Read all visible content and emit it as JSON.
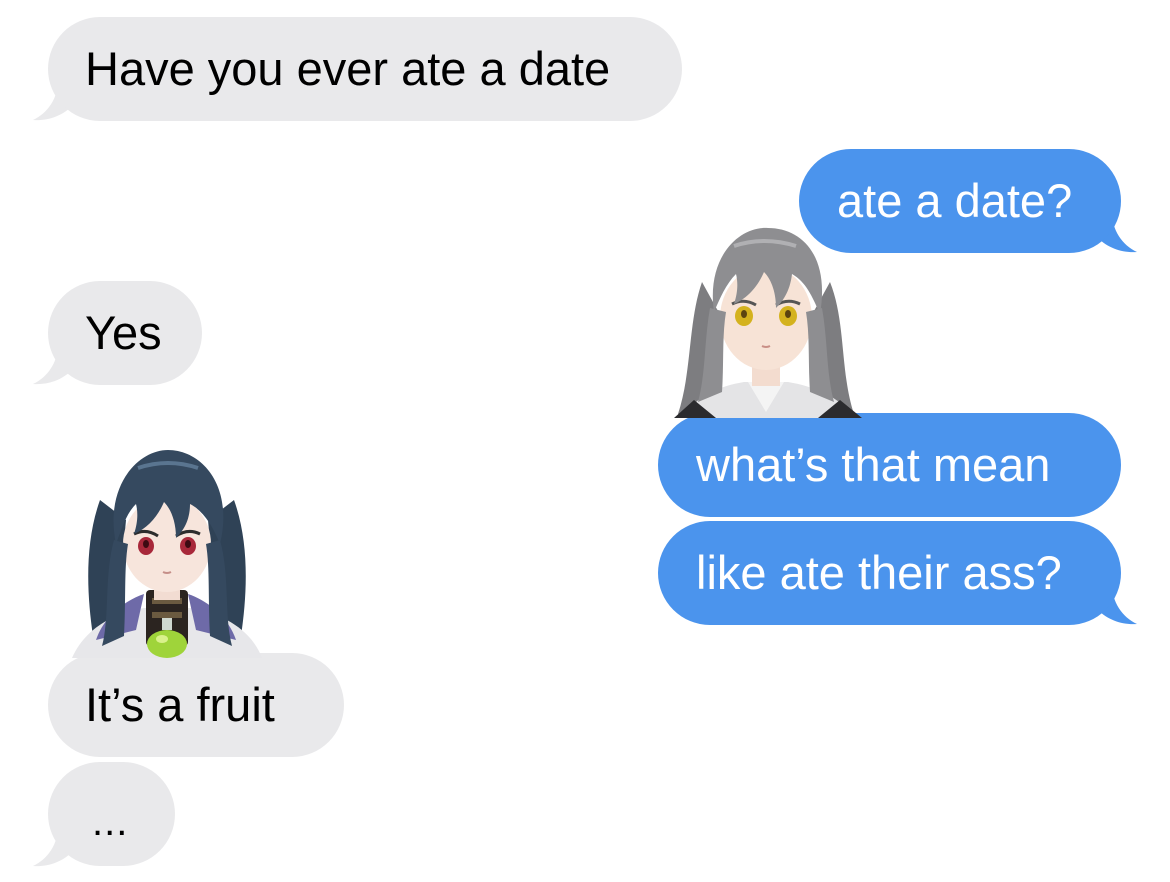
{
  "conversation": {
    "messages": [
      {
        "sender": "them",
        "text": "Have you ever ate a date"
      },
      {
        "sender": "me",
        "text": "ate a date?"
      },
      {
        "sender": "them",
        "text": "Yes"
      },
      {
        "sender": "me",
        "text": "what’s that mean"
      },
      {
        "sender": "me",
        "text": "like ate their ass?"
      },
      {
        "sender": "them",
        "text": "It’s a fruit"
      }
    ],
    "typing_indicator": "..."
  },
  "colors": {
    "incoming_bubble": "#e9e9eb",
    "outgoing_bubble": "#4b94ed",
    "incoming_text": "#000000",
    "outgoing_text": "#ffffff",
    "background": "#ffffff"
  },
  "stickers": [
    {
      "name": "grey-haired-anime-girl-sticker",
      "hair": "#8a8a8c",
      "eyes": "#d4b21e"
    },
    {
      "name": "dark-haired-anime-boy-sticker",
      "hair": "#35495f",
      "eyes": "#a8283a",
      "accent": "#9fd43a"
    }
  ]
}
